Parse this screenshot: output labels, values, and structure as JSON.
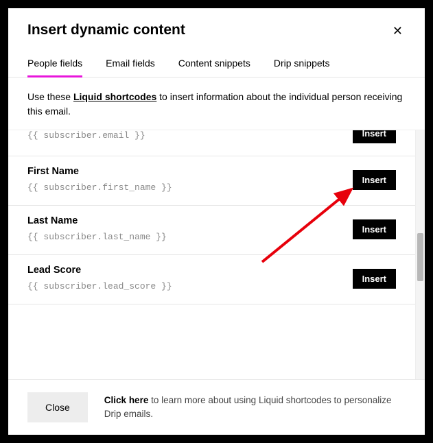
{
  "modal": {
    "title": "Insert dynamic content"
  },
  "tabs": {
    "people": "People fields",
    "email": "Email fields",
    "content": "Content snippets",
    "drip": "Drip snippets"
  },
  "desc": {
    "pre": "Use these ",
    "link": "Liquid shortcodes",
    "post": " to insert information about the individual person receiving this email."
  },
  "fields": {
    "email_code": "{{ subscriber.email }}",
    "first_label": "First Name",
    "first_code": "{{ subscriber.first_name }}",
    "last_label": "Last Name",
    "last_code": "{{ subscriber.last_name }}",
    "lead_label": "Lead Score",
    "lead_code": "{{ subscriber.lead_score }}"
  },
  "buttons": {
    "insert": "Insert",
    "close": "Close"
  },
  "footer": {
    "click": "Click here",
    "text": " to learn more about using Liquid shortcodes to personalize Drip emails."
  }
}
